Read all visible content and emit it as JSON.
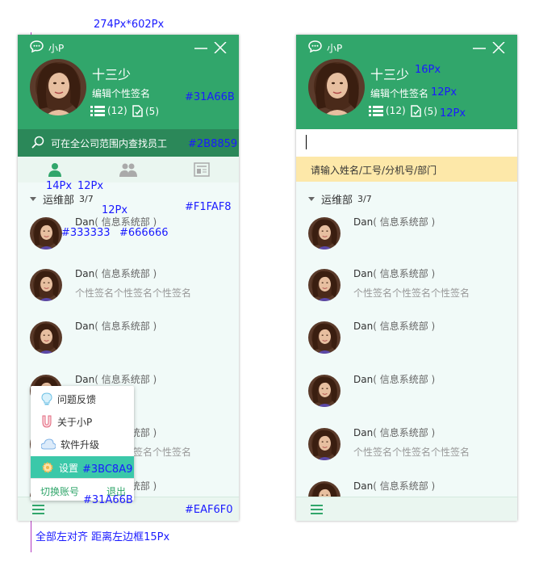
{
  "annotations": {
    "window_size": "274Px*602Px",
    "header_color": "#31A66B",
    "search_color": "#2B8859",
    "list_bg_color": "#F1FAF8",
    "group_font": "14Px",
    "group_count_font": "12Px",
    "dept_font": "12Px",
    "name_color": "#333333",
    "dept_color": "#666666",
    "menu_active_color": "#3BC8A9",
    "footer_icon_color": "#31A66B",
    "footer_bg_color": "#EAF6F0",
    "name_font": "16Px",
    "sig_font": "12Px",
    "stat_font": "12Px",
    "align_note": "全部左对齐 距离左边框15Px"
  },
  "app": {
    "name": "小P",
    "logo_icon": "chat-bubble-icon",
    "minimize_icon": "minimize-icon",
    "close_icon": "close-icon"
  },
  "profile": {
    "name": "十三少",
    "signature": "编辑个性签名",
    "list_count": "(12)",
    "doc_count": "(5)"
  },
  "search": {
    "placeholder": "可在全公司范围内查找员工",
    "hint": "请输入姓名/工号/分机号/部门"
  },
  "tabs": [
    "contacts-tab",
    "groups-tab",
    "news-tab"
  ],
  "group": {
    "name": "运维部",
    "count": "3/7"
  },
  "contacts_a": [
    {
      "name": "Dan",
      "dept": "( 信息系统部 )",
      "signature": ""
    },
    {
      "name": "Dan",
      "dept": "( 信息系统部 )",
      "signature": "个性签名个性签名个性签名"
    },
    {
      "name": "Dan",
      "dept": "( 信息系统部 )",
      "signature": ""
    },
    {
      "name": "Dan",
      "dept": "( 信息系统部 )",
      "signature": ""
    },
    {
      "name": "Dan",
      "dept": "( 信息系统部 )",
      "signature": "个性签名个性签名个性签名"
    },
    {
      "name": "Dan",
      "dept": "( 信息系统部 )",
      "signature": ""
    }
  ],
  "contacts_b": [
    {
      "name": "Dan",
      "dept": "( 信息系统部 )",
      "signature": ""
    },
    {
      "name": "Dan",
      "dept": "( 信息系统部 )",
      "signature": "个性签名个性签名个性签名"
    },
    {
      "name": "Dan",
      "dept": "( 信息系统部 )",
      "signature": ""
    },
    {
      "name": "Dan",
      "dept": "( 信息系统部 )",
      "signature": ""
    },
    {
      "name": "Dan",
      "dept": "( 信息系统部 )",
      "signature": "个性签名个性签名个性签名"
    },
    {
      "name": "Dan",
      "dept": "( 信息系统部 )",
      "signature": ""
    }
  ],
  "menu": {
    "items": [
      {
        "label": "问题反馈",
        "icon": "lightbulb-icon"
      },
      {
        "label": "关于小P",
        "icon": "magnet-icon"
      },
      {
        "label": "软件升级",
        "icon": "cloud-icon"
      },
      {
        "label": "设置",
        "icon": "gear-icon"
      }
    ],
    "switch_account": "切换账号",
    "logout": "退出"
  },
  "colors": {
    "header": "#31a66b",
    "search_bar": "#2b8859",
    "list_bg": "#f1faf8",
    "tab_bg": "#eaf6f0",
    "menu_active": "#3bc8a9",
    "hint_bg": "#fde8a9"
  }
}
